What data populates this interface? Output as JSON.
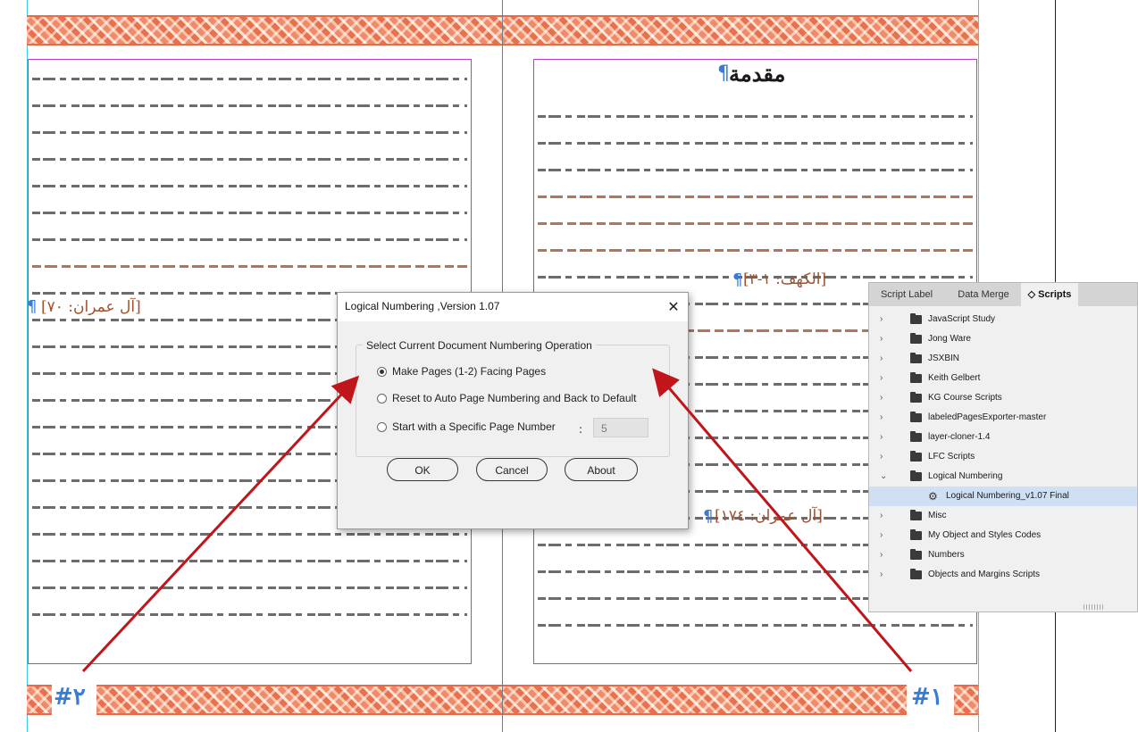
{
  "left_page": {
    "page_number": "#٢",
    "reference": "[آل عمران: ٧٠]",
    "pilcrow": "¶"
  },
  "right_page": {
    "heading": "مقدمة",
    "heading_pilcrow": "¶",
    "reference_1": "[الكهف: ١-٣]",
    "reference_2": "[آل عمران: ١٧٤]",
    "pilcrow": "¶",
    "page_number": "#١"
  },
  "dialog": {
    "title": "Logical Numbering ,Version 1.07",
    "close_glyph": "✕",
    "group_label": "Select Current Document Numbering Operation",
    "options": [
      {
        "label": "Make Pages (1-2) Facing Pages",
        "selected": true
      },
      {
        "label": "Reset to Auto Page Numbering and Back to Default",
        "selected": false
      },
      {
        "label": "Start with a Specific Page Number",
        "selected": false
      }
    ],
    "colon": ":",
    "start_number": "5",
    "buttons": {
      "ok": "OK",
      "cancel": "Cancel",
      "about": "About"
    }
  },
  "scripts_panel": {
    "tabs": [
      "Script Label",
      "Data Merge",
      "◇ Scripts"
    ],
    "active_tab": "◇ Scripts",
    "items": [
      {
        "label": "JavaScript Study",
        "expanded": false
      },
      {
        "label": "Jong Ware",
        "expanded": false
      },
      {
        "label": "JSXBIN",
        "expanded": false
      },
      {
        "label": "Keith Gelbert",
        "expanded": false
      },
      {
        "label": "KG Course Scripts",
        "expanded": false
      },
      {
        "label": "labeledPagesExporter-master",
        "expanded": false
      },
      {
        "label": "layer-cloner-1.4",
        "expanded": false
      },
      {
        "label": "LFC Scripts",
        "expanded": false
      },
      {
        "label": "Logical Numbering",
        "expanded": true
      },
      {
        "label": "Logical Numbering_v1.07 Final",
        "is_script": true,
        "selected": true
      },
      {
        "label": "Misc",
        "expanded": false
      },
      {
        "label": "My Object and Styles Codes",
        "expanded": false
      },
      {
        "label": "Numbers",
        "expanded": false
      },
      {
        "label": "Objects and Margins Scripts",
        "expanded": false
      }
    ]
  },
  "colors": {
    "frame": "#b440c8",
    "bleed": "#41c8e6",
    "ornament": "#f08a6a",
    "arrow": "#c0151a",
    "accent_blue": "#3a7bd5"
  }
}
